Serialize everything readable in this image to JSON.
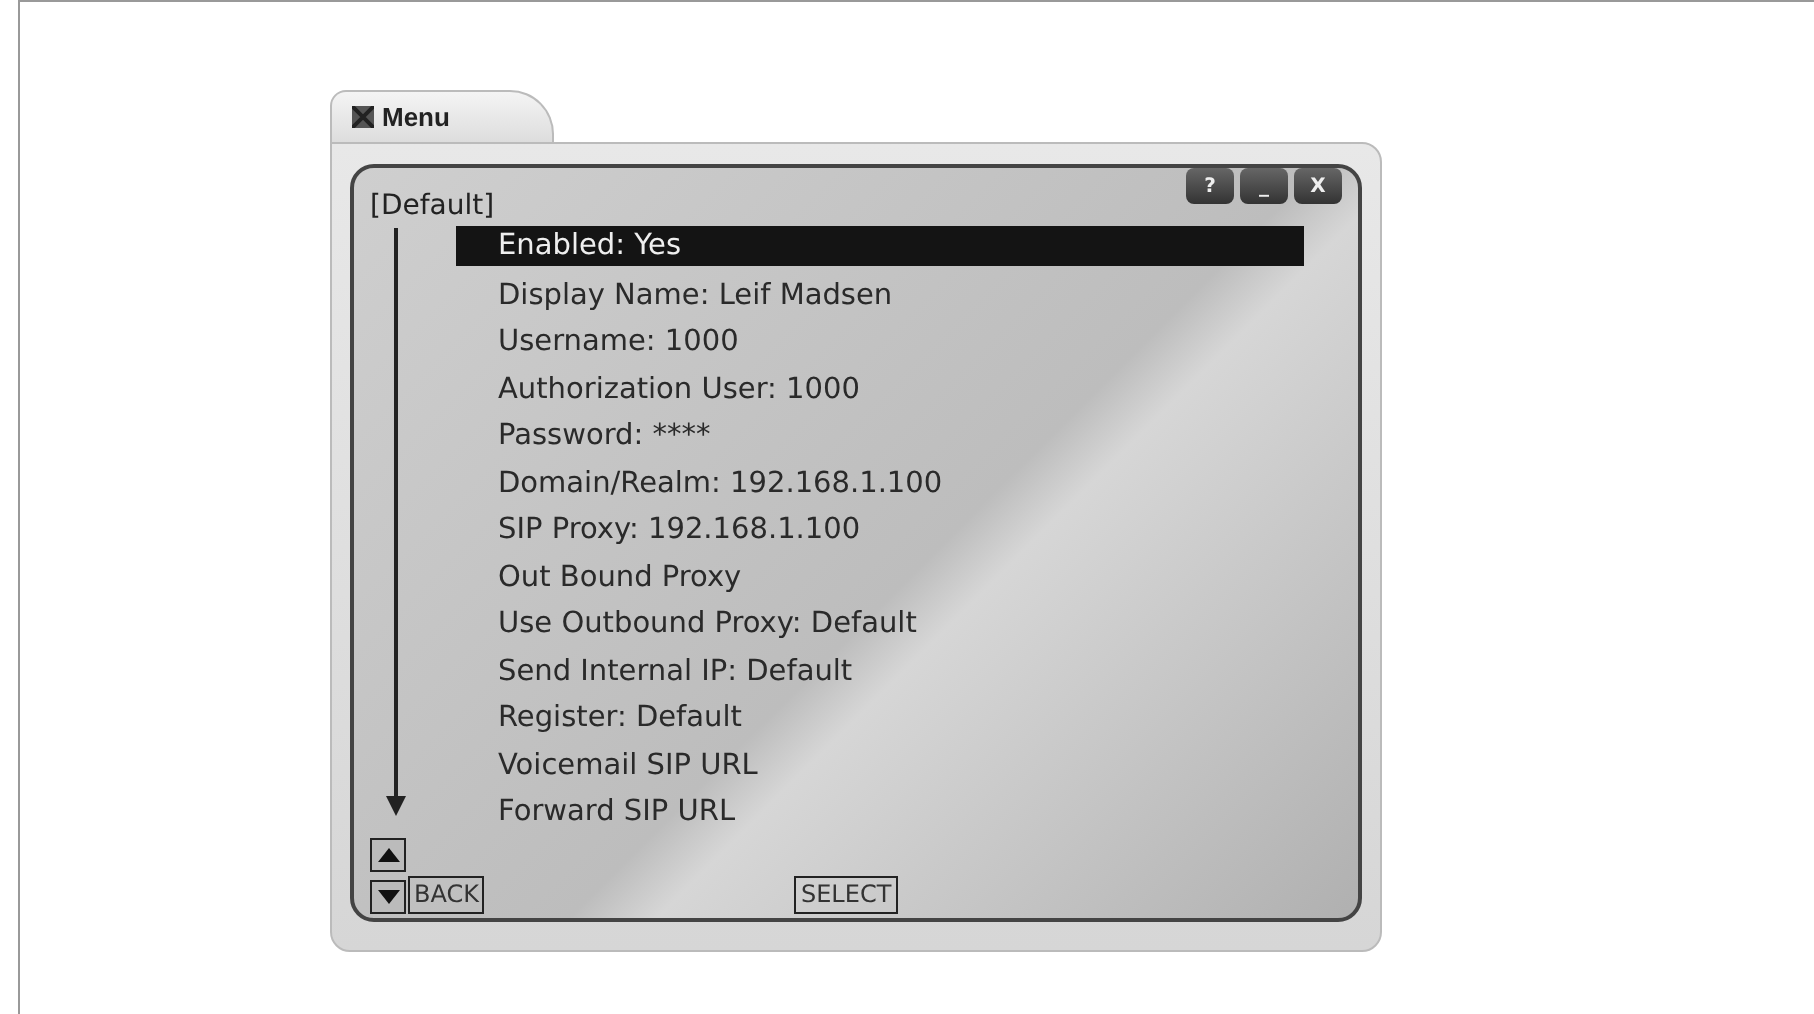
{
  "window": {
    "title": "Menu",
    "buttons": [
      "?",
      "_",
      "X"
    ]
  },
  "header": "[Default]",
  "items": [
    {
      "label": "Enabled: Yes",
      "selected": true
    },
    {
      "label": "Display Name: Leif Madsen",
      "selected": false
    },
    {
      "label": "Username: 1000",
      "selected": false
    },
    {
      "label": "Authorization User: 1000",
      "selected": false
    },
    {
      "label": "Password: ****",
      "selected": false
    },
    {
      "label": "Domain/Realm: 192.168.1.100",
      "selected": false
    },
    {
      "label": "SIP Proxy: 192.168.1.100",
      "selected": false
    },
    {
      "label": "Out Bound Proxy",
      "selected": false
    },
    {
      "label": "Use Outbound Proxy: Default",
      "selected": false
    },
    {
      "label": "Send Internal IP: Default",
      "selected": false
    },
    {
      "label": "Register: Default",
      "selected": false
    },
    {
      "label": "Voicemail SIP URL",
      "selected": false
    },
    {
      "label": "Forward SIP URL",
      "selected": false
    }
  ],
  "softkeys": [
    "BACK",
    "SELECT"
  ]
}
